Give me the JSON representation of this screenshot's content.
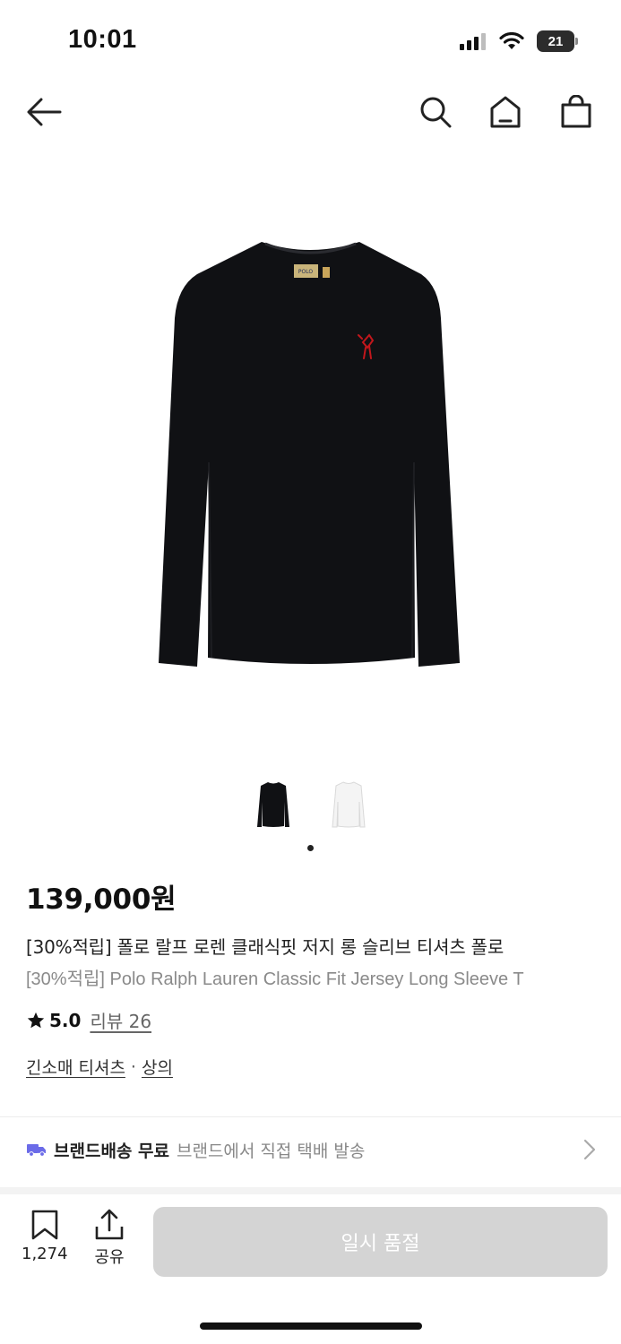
{
  "status": {
    "time": "10:01",
    "battery": "21",
    "icons": [
      "signal-icon",
      "wifi-icon",
      "battery-icon"
    ]
  },
  "nav": {
    "icons": [
      "back-arrow-icon",
      "search-icon",
      "home-icon",
      "shopping-bag-icon"
    ]
  },
  "product": {
    "price": "139,000원",
    "title_ko": "[30%적립] 폴로 랄프 로렌 클래식핏 저지 롱 슬리브 티셔츠 폴로",
    "title_en": "[30%적립] Polo Ralph Lauren Classic Fit Jersey Long Sleeve T",
    "rating": "5.0",
    "reviews": "리뷰 26",
    "category_1": "긴소매 티셔츠",
    "category_sep": "·",
    "category_2": "상의",
    "colors": {
      "black": "#101114",
      "white": "#f4f4f4",
      "logo_red": "#c2171c"
    }
  },
  "shipping": {
    "bold": "브랜드배송 무료",
    "desc": "브랜드에서 직접 택배 발송",
    "icon_color": "#6b6be8"
  },
  "bottom": {
    "wishlist_count": "1,274",
    "share_label": "공유",
    "buy_label": "일시 품절"
  }
}
